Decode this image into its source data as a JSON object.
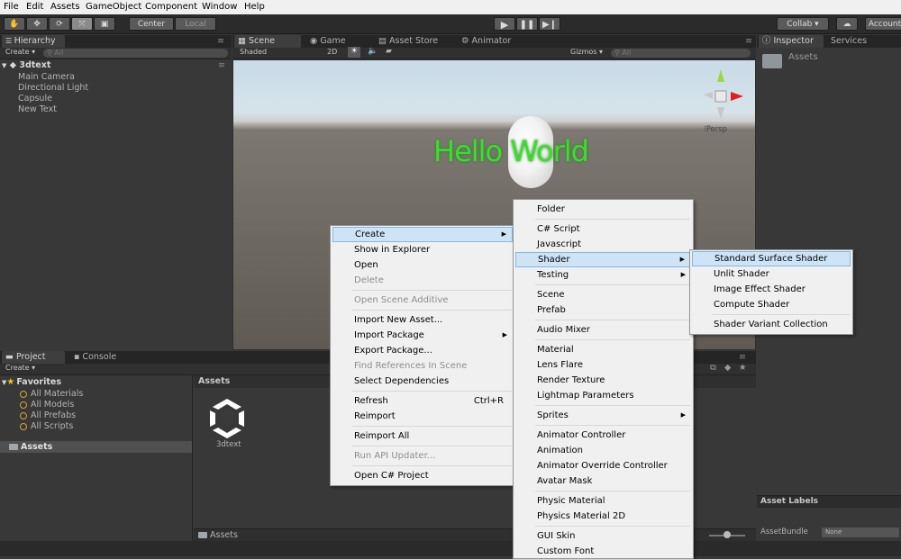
{
  "menubar": [
    "File",
    "Edit",
    "Assets",
    "GameObject",
    "Component",
    "Window",
    "Help"
  ],
  "toolbar": {
    "tools": [
      "hand-icon",
      "move-icon",
      "rotate-icon",
      "scale-icon",
      "rect-icon"
    ],
    "pivot": "Center",
    "space": "Local",
    "play_icons": [
      "play-icon",
      "pause-icon",
      "step-icon"
    ],
    "collab": "Collab ▾",
    "account": "Account"
  },
  "hierarchy": {
    "tab": "Hierarchy",
    "create": "Create ▾",
    "search": "All",
    "scene": "3dtext",
    "items": [
      "Main Camera",
      "Directional Light",
      "Capsule",
      "New Text"
    ]
  },
  "scene_tabs": [
    "Scene",
    "Game",
    "Asset Store",
    "Animator"
  ],
  "scene_bar": {
    "shading": "Shaded",
    "mode2d": "2D",
    "gizmos": "Gizmos ▾",
    "search": "All"
  },
  "scene": {
    "text": "Hello World",
    "persp": "Persp"
  },
  "inspector": {
    "tabs": [
      "Inspector",
      "Services"
    ],
    "title": "Assets",
    "labels": "Asset Labels",
    "bundle_label": "AssetBundle",
    "bundle_value": "None"
  },
  "project": {
    "tabs": [
      "Project",
      "Console"
    ],
    "create": "Create ▾",
    "favorites": "Favorites",
    "fav_items": [
      "All Materials",
      "All Models",
      "All Prefabs",
      "All Scripts"
    ],
    "assets_root": "Assets",
    "assets_header": "Assets",
    "asset_name": "3dtext",
    "footer": "Assets"
  },
  "menu1": {
    "items": [
      {
        "label": "Create",
        "arrow": true,
        "hl": true
      },
      {
        "label": "Show in Explorer"
      },
      {
        "label": "Open"
      },
      {
        "label": "Delete",
        "dis": true
      },
      {
        "label": "Open Scene Additive",
        "dis": true
      },
      {
        "label": "Import New Asset..."
      },
      {
        "label": "Import Package",
        "arrow": true
      },
      {
        "label": "Export Package..."
      },
      {
        "label": "Find References In Scene",
        "dis": true
      },
      {
        "label": "Select Dependencies"
      },
      {
        "label": "Refresh",
        "short": "Ctrl+R"
      },
      {
        "label": "Reimport"
      },
      {
        "label": "Reimport All"
      },
      {
        "label": "Run API Updater...",
        "dis": true
      },
      {
        "label": "Open C# Project"
      }
    ]
  },
  "menu2": {
    "items": [
      {
        "label": "Folder"
      },
      {
        "label": "C# Script"
      },
      {
        "label": "Javascript"
      },
      {
        "label": "Shader",
        "arrow": true,
        "hl": true
      },
      {
        "label": "Testing",
        "arrow": true
      },
      {
        "label": "Scene"
      },
      {
        "label": "Prefab"
      },
      {
        "label": "Audio Mixer"
      },
      {
        "label": "Material"
      },
      {
        "label": "Lens Flare"
      },
      {
        "label": "Render Texture"
      },
      {
        "label": "Lightmap Parameters"
      },
      {
        "label": "Sprites",
        "arrow": true
      },
      {
        "label": "Animator Controller"
      },
      {
        "label": "Animation"
      },
      {
        "label": "Animator Override Controller"
      },
      {
        "label": "Avatar Mask"
      },
      {
        "label": "Physic Material"
      },
      {
        "label": "Physics Material 2D"
      },
      {
        "label": "GUI Skin"
      },
      {
        "label": "Custom Font"
      }
    ]
  },
  "menu3": {
    "items": [
      {
        "label": "Standard Surface Shader",
        "hl": true
      },
      {
        "label": "Unlit Shader"
      },
      {
        "label": "Image Effect Shader"
      },
      {
        "label": "Compute Shader"
      },
      {
        "label": "Shader Variant Collection"
      }
    ]
  }
}
